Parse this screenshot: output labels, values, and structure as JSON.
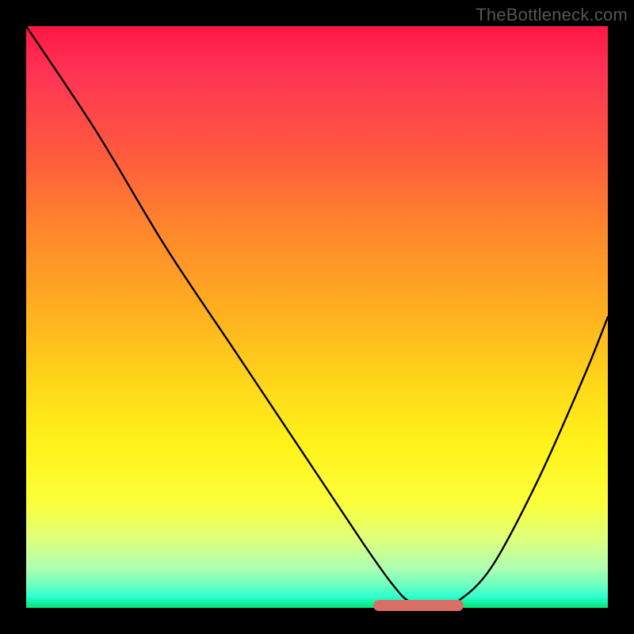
{
  "watermark": "TheBottleneck.com",
  "chart_data": {
    "type": "line",
    "title": "",
    "xlabel": "",
    "ylabel": "",
    "xlim": [
      0,
      100
    ],
    "ylim": [
      0,
      100
    ],
    "grid": false,
    "series": [
      {
        "name": "curve",
        "x": [
          0,
          12,
          24,
          36,
          48,
          58,
          63,
          66,
          70,
          74,
          80,
          88,
          96,
          100
        ],
        "values": [
          100,
          82,
          62,
          44,
          26,
          11,
          4,
          1,
          0,
          1,
          7,
          22,
          40,
          50
        ]
      }
    ],
    "highlight_range": {
      "x_start": 60,
      "x_end": 75,
      "y": 0
    },
    "background": "rainbow-gradient-red-to-green-vertical"
  }
}
